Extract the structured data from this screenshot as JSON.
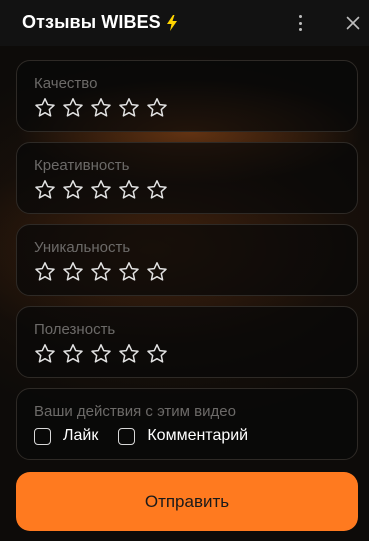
{
  "header": {
    "title": "Отзывы WIBES",
    "accent_color": "#FFD400",
    "icons": [
      "lightning-icon",
      "more-vertical-icon",
      "close-icon"
    ]
  },
  "ratings": [
    {
      "label": "Качество",
      "stars_total": 5,
      "stars_selected": 0
    },
    {
      "label": "Креативность",
      "stars_total": 5,
      "stars_selected": 0
    },
    {
      "label": "Уникальность",
      "stars_total": 5,
      "stars_selected": 0
    },
    {
      "label": "Полезность",
      "stars_total": 5,
      "stars_selected": 0
    }
  ],
  "actions": {
    "label": "Ваши действия с этим видео",
    "options": [
      {
        "label": "Лайк",
        "checked": false
      },
      {
        "label": "Комментарий",
        "checked": false
      }
    ]
  },
  "submit": {
    "label": "Отправить",
    "color": "#FF7A1F"
  }
}
